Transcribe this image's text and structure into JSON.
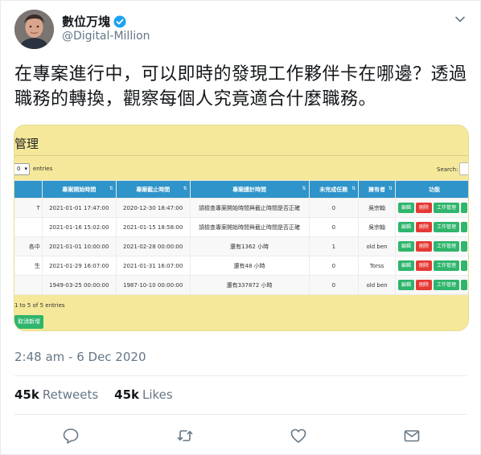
{
  "user": {
    "display_name": "數位万塊",
    "handle": "@Digital-Million"
  },
  "tweet": {
    "text": "在專案進行中，可以即時的發現工作夥伴卡在哪邊？透過職務的轉換，觀察每個人究竟適合什麼職務。",
    "timestamp": "2:48 am - 6 Dec 2020"
  },
  "stats": {
    "retweets_count": "45k",
    "retweets_label": "Retweets",
    "likes_count": "45k",
    "likes_label": "Likes"
  },
  "media": {
    "title": "管理",
    "select_value": "0",
    "entries_label": "entries",
    "search_label": "Search:",
    "headers": [
      "專案開始時間",
      "專案截止時間",
      "專案總計時間",
      "未完成任務",
      "擁有者",
      "功能"
    ],
    "rows": [
      {
        "first": "T",
        "start": "2021-01-01 17:47:00",
        "end": "2020-12-30 18:47:00",
        "total": "請檢查專案開始時間與截止時間是否正確",
        "unfinished": "0",
        "owner": "吳宗翰"
      },
      {
        "first": "",
        "start": "2021-01-16 15:02:00",
        "end": "2021-01-15 18:58:00",
        "total": "請檢查專案開始時間與截止時間是否正確",
        "unfinished": "0",
        "owner": "吳宗翰"
      },
      {
        "first": "各中",
        "start": "2021-01-01 10:00:00",
        "end": "2021-02-28 00:00:00",
        "total": "還有1362 小時",
        "unfinished": "1",
        "owner": "old ben"
      },
      {
        "first": "生",
        "start": "2021-01-29 16:07:00",
        "end": "2021-01-31 16:07:00",
        "total": "還有48 小時",
        "unfinished": "0",
        "owner": "Torss"
      },
      {
        "first": "",
        "start": "1949-03-25 00:00:00",
        "end": "1987-10-10 00:00:00",
        "total": "還有337872 小時",
        "unfinished": "0",
        "owner": "old ben"
      }
    ],
    "actions": {
      "edit": "編輯",
      "delete": "刪除",
      "work": "工作管理"
    },
    "info": "1 to 5 of 5 entries",
    "cancel_label": "取消新增"
  },
  "icons": {
    "verified": "verified-badge-icon",
    "caret": "chevron-down-icon",
    "reply": "reply-icon",
    "retweet": "retweet-icon",
    "like": "heart-icon",
    "share": "share-mail-icon"
  },
  "colors": {
    "accent": "#1da1f2",
    "text_secondary": "#657786",
    "media_bg": "#f5e89b",
    "table_header": "#2e94c9",
    "btn_green": "#2fb56c",
    "btn_red": "#e53935"
  }
}
